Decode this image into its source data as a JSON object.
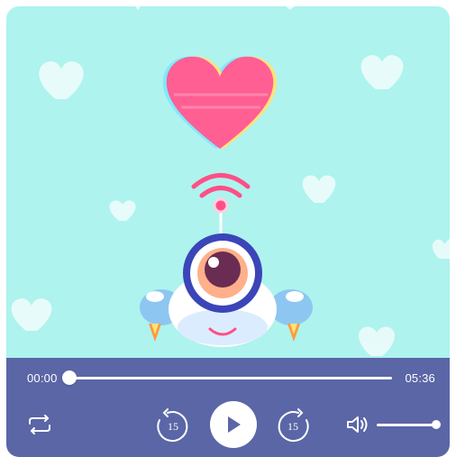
{
  "player": {
    "current_time": "00:00",
    "duration": "05:36",
    "progress": 0.0,
    "volume": 1.0,
    "skip_back_seconds": "15",
    "skip_forward_seconds": "15"
  },
  "colors": {
    "artwork_bg": "#aef3ee",
    "control_bar": "#5a66a6",
    "heart": "#ff5f93",
    "accent": "#ffffff"
  },
  "icons": [
    "repeat-icon",
    "rewind-15-icon",
    "play-icon",
    "forward-15-icon",
    "volume-icon"
  ]
}
